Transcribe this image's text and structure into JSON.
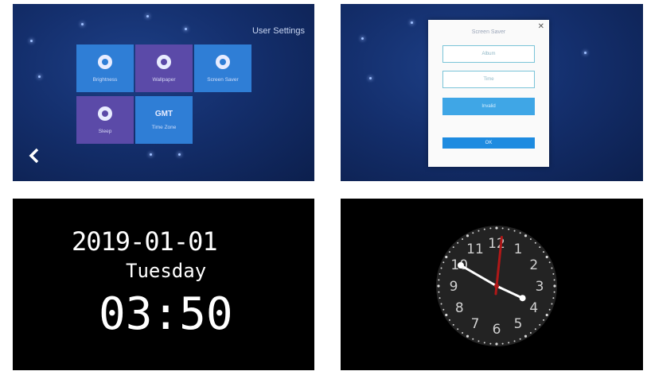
{
  "settings_screen": {
    "title": "User Settings",
    "back_icon": "chevron-left-icon",
    "tiles": [
      {
        "label": "Brightness",
        "color": "#2f7ed6",
        "icon": "brightness-icon"
      },
      {
        "label": "Wallpaper",
        "color": "#5b4aa8",
        "icon": "wallpaper-icon"
      },
      {
        "label": "Screen Saver",
        "color": "#2f7ed6",
        "icon": "screen-saver-icon"
      },
      {
        "label": "Sleep",
        "color": "#5b4aa8",
        "icon": "sleep-icon"
      },
      {
        "label": "Time Zone",
        "color": "#2f7ed6",
        "badge": "GMT"
      }
    ]
  },
  "screen_saver_dialog": {
    "title": "Screen Saver",
    "close_icon": "close-icon",
    "options": [
      "Album",
      "Time",
      "Invalid"
    ],
    "selected_option": "Invalid",
    "ok_label": "OK"
  },
  "digital_clock": {
    "date": "2019-01-01",
    "weekday": "Tuesday",
    "time": "03:50"
  },
  "analog_clock": {
    "numerals": [
      "12",
      "1",
      "2",
      "3",
      "4",
      "5",
      "6",
      "7",
      "8",
      "9",
      "10",
      "11"
    ],
    "hour": 3,
    "minute": 50,
    "second": 1,
    "hand_color": "#ffffff",
    "second_hand_color": "#b01818"
  }
}
